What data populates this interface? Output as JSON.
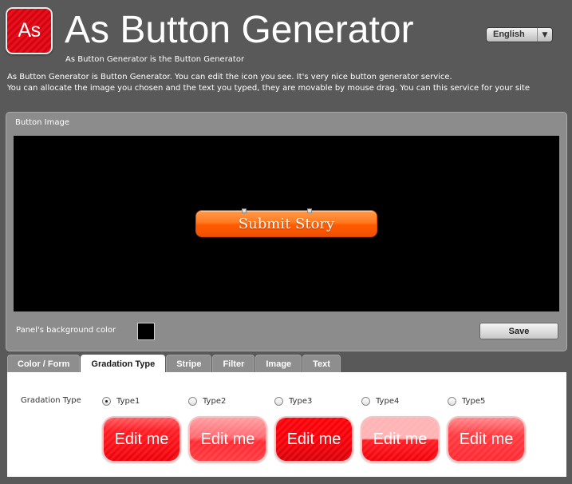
{
  "header": {
    "logo_text": "As",
    "title": "As Button Generator",
    "subtitle": "As Button Generator is the Button Generator"
  },
  "language": {
    "selected": "English"
  },
  "intro": {
    "line1": "As Button Generator is Button Generator. You can edit the icon you see. It's very nice button generator service.",
    "line2": "You can allocate the image you chosen and the text you typed, they are movable by mouse drag. You can this service for your site"
  },
  "button_image_panel": {
    "title": "Button Image",
    "preview_button_text": "Submit Story",
    "preview_button_color": "#ff6a00",
    "background_color_label": "Panel's background color",
    "background_color": "#000000",
    "save_label": "Save"
  },
  "tabs": [
    {
      "label": "Color / Form",
      "active": false
    },
    {
      "label": "Gradation Type",
      "active": true
    },
    {
      "label": "Stripe",
      "active": false
    },
    {
      "label": "Filter",
      "active": false
    },
    {
      "label": "Image",
      "active": false
    },
    {
      "label": "Text",
      "active": false
    }
  ],
  "gradation": {
    "label": "Gradation Type",
    "selected": "Type1",
    "options": [
      {
        "label": "Type1",
        "sample_text": "Edit me"
      },
      {
        "label": "Type2",
        "sample_text": "Edit me"
      },
      {
        "label": "Type3",
        "sample_text": "Edit me"
      },
      {
        "label": "Type4",
        "sample_text": "Edit me"
      },
      {
        "label": "Type5",
        "sample_text": "Edit me"
      }
    ]
  },
  "colors": {
    "background": "#595959",
    "panel": "#8c8c8c",
    "accent_red": "#ff1d24"
  }
}
